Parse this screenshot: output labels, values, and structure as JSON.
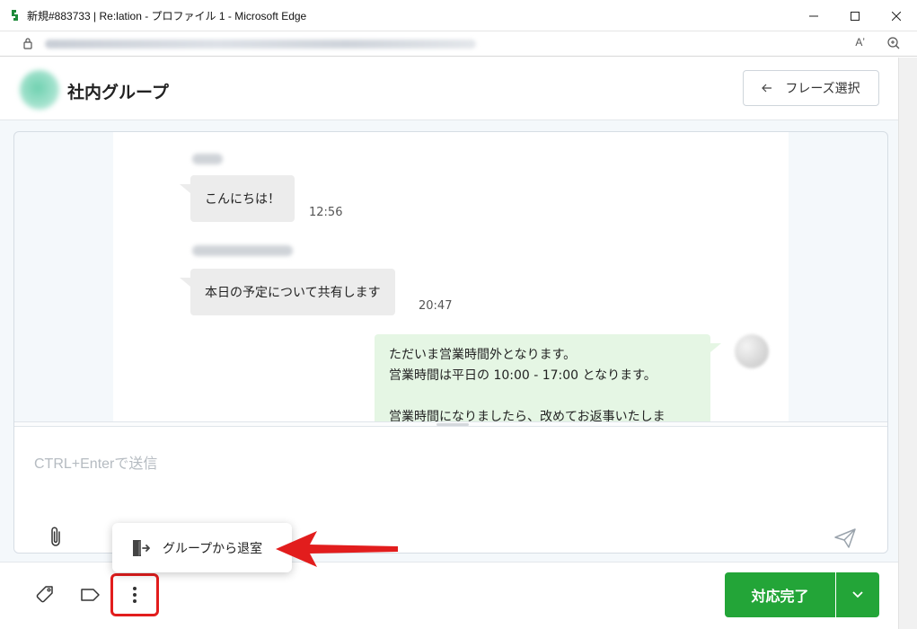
{
  "browser": {
    "title": "新規#883733 | Re:lation - プロファイル 1 - Microsoft Edge",
    "read_aloud": "Aʼ"
  },
  "header": {
    "group_name": "社内グループ",
    "phrase_button": "フレーズ選択"
  },
  "messages": [
    {
      "direction": "in",
      "text": "こんにちは！",
      "time": "12:56"
    },
    {
      "direction": "in",
      "text": "本日の予定について共有します",
      "time": "20:47"
    },
    {
      "direction": "out",
      "lines": [
        "ただいま営業時間外となります。",
        "営業時間は平日の 10:00 - 17:00 となります。",
        "",
        "営業時間になりましたら、改めてお返事いたしま"
      ]
    }
  ],
  "compose": {
    "placeholder": "CTRL+Enterで送信"
  },
  "popup": {
    "leave_group_label": "グループから退室"
  },
  "footer": {
    "complete_button": "対応完了"
  },
  "colors": {
    "primary_green": "#23a538",
    "highlight_red": "#e21d1d",
    "outgoing_bubble": "#e5f6e4",
    "incoming_bubble": "#ececec"
  },
  "icons": [
    "lock-icon",
    "read-aloud-icon",
    "zoom-icon",
    "arrow-left-icon",
    "attachment-icon",
    "send-icon",
    "tag-icon",
    "label-icon",
    "more-vertical-icon",
    "exit-icon",
    "chevron-down-icon"
  ]
}
